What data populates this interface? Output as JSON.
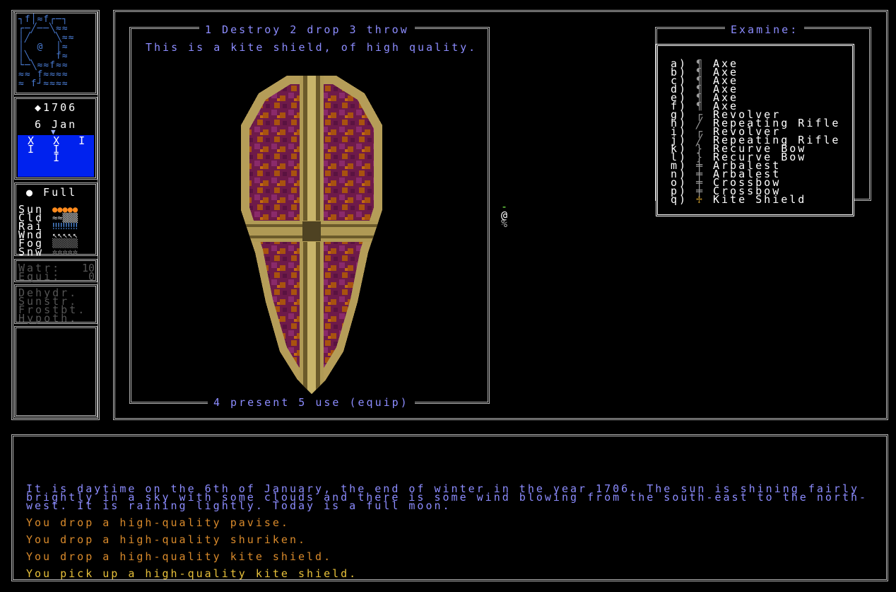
{
  "sidebar": {
    "minimap": {
      "rows": [
        "┐f│≈f┌─┐",
        "┌─╱──╲≈≈",
        "│╱    ╲≈≈",
        "│  @  │≈",
        "│╲    f≈",
        "└─╲≈≈f≈≈",
        "≈≈ f≈≈≈≈",
        "≈ f┘≈≈≈≈"
      ]
    },
    "year": "◆1706",
    "date": "6 Jan",
    "calendar_marker": "▼",
    "calendar_rows": [
      "X  X  I",
      "I  I",
      "   I"
    ],
    "moon": "● Full",
    "weather": [
      {
        "label": "Sun",
        "bar": "●●●●●"
      },
      {
        "label": "Cld",
        "bar": "≈≈▒▒▒"
      },
      {
        "label": "Rai",
        "bar": "‼‼‼‼‼"
      },
      {
        "label": "Wnd",
        "bar": "↖↖↖↖↖"
      },
      {
        "label": "Fog",
        "bar": "▒▒▒▒▒"
      },
      {
        "label": "Snw",
        "bar": "✲✲✲✲✲"
      }
    ],
    "stats": [
      {
        "label": "Watr:",
        "value": "10"
      },
      {
        "label": "Equi:",
        "value": "0"
      }
    ],
    "conditions": [
      "Dehydr.",
      "Sunstr.",
      "Frostbt.",
      "Hypoth."
    ]
  },
  "item_panel": {
    "top_actions": "1 Destroy 2 drop 3 throw",
    "description": "This is a kite shield, of high quality.",
    "bottom_actions": "4 present 5 use (equip)"
  },
  "map_glyphs": [
    "-",
    "@",
    "%"
  ],
  "examine": {
    "title": "Examine:",
    "items": [
      {
        "key": "a)",
        "icon": "¶",
        "name": "Axe"
      },
      {
        "key": "b)",
        "icon": "¶",
        "name": "Axe"
      },
      {
        "key": "c)",
        "icon": "¶",
        "name": "Axe"
      },
      {
        "key": "d)",
        "icon": "¶",
        "name": "Axe"
      },
      {
        "key": "e)",
        "icon": "¶",
        "name": "Axe"
      },
      {
        "key": "f)",
        "icon": "¶",
        "name": "Axe"
      },
      {
        "key": "g)",
        "icon": "┌",
        "name": "Revolver"
      },
      {
        "key": "h)",
        "icon": "╱",
        "name": "Repeating Rifle"
      },
      {
        "key": "i)",
        "icon": "┌",
        "name": "Revolver"
      },
      {
        "key": "j)",
        "icon": "╱",
        "name": "Repeating Rifle"
      },
      {
        "key": "k)",
        "icon": "}",
        "name": "Recurve Bow"
      },
      {
        "key": "l)",
        "icon": "}",
        "name": "Recurve Bow"
      },
      {
        "key": "m)",
        "icon": "╪",
        "name": "Arbalest"
      },
      {
        "key": "n)",
        "icon": "╪",
        "name": "Arbalest"
      },
      {
        "key": "o)",
        "icon": "╪",
        "name": "Crossbow"
      },
      {
        "key": "p)",
        "icon": "╪",
        "name": "Crossbow"
      },
      {
        "key": "q)",
        "icon": "♱",
        "name": "Kite Shield"
      }
    ]
  },
  "log": {
    "narration": [
      "It is daytime on the 6th of January, the end of winter in the year 1706. The sun is shining fairly",
      "brightly in a sky with some clouds and there is some wind blowing from the south-east to the north-",
      "west. It is raining lightly. Today is a full moon."
    ],
    "messages": [
      {
        "text": "You drop a high-quality pavise.",
        "tone": "orange"
      },
      {
        "text": "You drop a high-quality shuriken.",
        "tone": "orange"
      },
      {
        "text": "You drop a high-quality kite shield.",
        "tone": "orange"
      },
      {
        "text": "You pick up a high-quality kite shield.",
        "tone": "yellow"
      }
    ]
  },
  "colors": {
    "text_blue": "#8c8cff",
    "calendar_bg": "#0022ee",
    "log_orange": "#d98a2b",
    "log_yellow": "#e8c13a",
    "border": "#b4b4b4"
  }
}
